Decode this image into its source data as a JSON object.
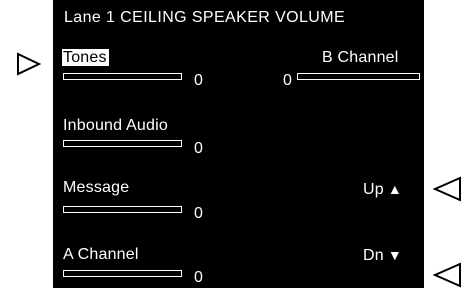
{
  "title": "Lane 1 CEILING SPEAKER VOLUME",
  "rows": {
    "tones": {
      "label": "Tones",
      "value": "0"
    },
    "b_channel": {
      "label": "B Channel",
      "value": "0"
    },
    "inbound_audio": {
      "label": "Inbound Audio",
      "value": "0"
    },
    "message": {
      "label": "Message",
      "value": "0"
    },
    "a_channel": {
      "label": "A Channel",
      "value": "0"
    }
  },
  "controls": {
    "up_label": "Up",
    "up_icon": "up-triangle-icon",
    "dn_label": "Dn",
    "dn_icon": "down-triangle-icon"
  },
  "colors": {
    "screen_background": "#000000",
    "text": "#ffffff",
    "page_background": "#ffffff"
  }
}
